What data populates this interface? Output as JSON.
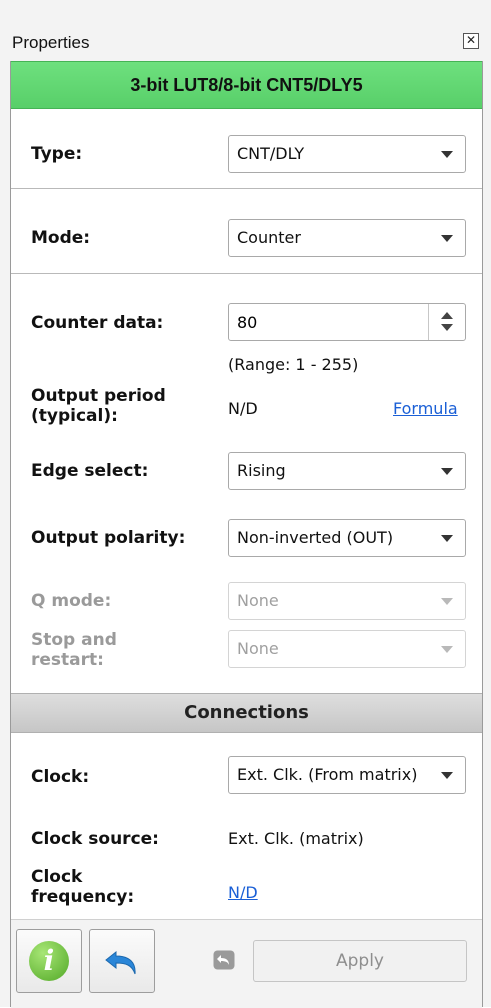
{
  "panel": {
    "title": "Properties",
    "close_glyph": "✕",
    "header": "3-bit LUT8/8-bit CNT5/DLY5"
  },
  "type": {
    "label": "Type:",
    "value": "CNT/DLY"
  },
  "mode": {
    "label": "Mode:",
    "value": "Counter"
  },
  "counter_data": {
    "label": "Counter data:",
    "value": "80",
    "range": "(Range:  1 - 255)"
  },
  "output_period": {
    "label": "Output period (typical):",
    "value": "N/D",
    "formula_link": "Formula"
  },
  "edge_select": {
    "label": "Edge select:",
    "value": "Rising"
  },
  "output_polarity": {
    "label": "Output polarity:",
    "value": "Non-inverted (OUT)"
  },
  "q_mode": {
    "label": "Q mode:",
    "value": "None",
    "enabled": false
  },
  "stop_restart": {
    "label": "Stop and restart:",
    "value": "None",
    "enabled": false
  },
  "connections": {
    "heading": "Connections",
    "clock": {
      "label": "Clock:",
      "value": "Ext. Clk. (From matrix)"
    },
    "clock_source": {
      "label": "Clock source:",
      "value": "Ext. Clk. (matrix)"
    },
    "clock_frequency": {
      "label": "Clock frequency:",
      "value": "N/D"
    }
  },
  "toolbar": {
    "info_glyph": "i",
    "apply_label": "Apply"
  },
  "colors": {
    "header_green": "#5fd46f",
    "link_blue": "#1a5fd6",
    "info_green": "#52a827",
    "undo_blue": "#2a86d8"
  },
  "icons": [
    "close-icon",
    "chevron-down-icon",
    "spin-up-icon",
    "spin-down-icon",
    "info-icon",
    "undo-icon"
  ]
}
